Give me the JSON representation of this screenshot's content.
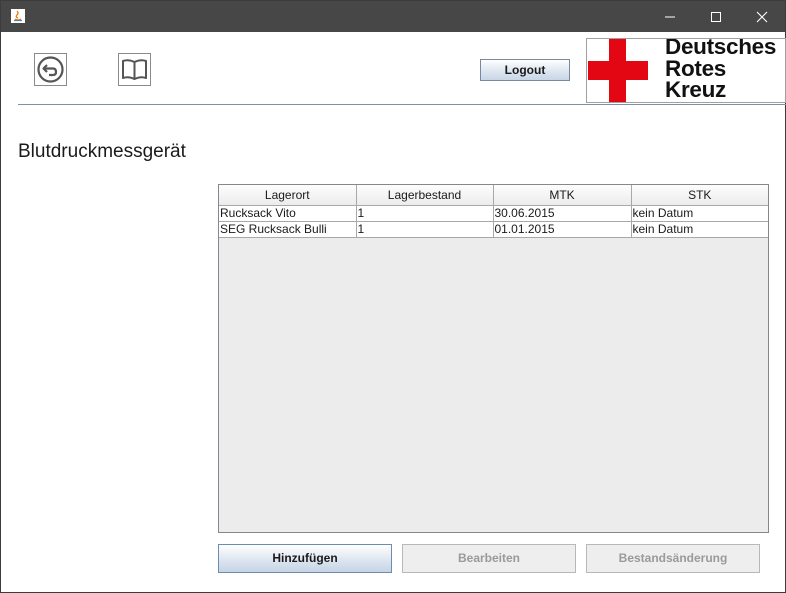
{
  "window": {
    "controls": {
      "minimize_icon": "minimize-icon",
      "maximize_icon": "maximize-icon",
      "close_icon": "close-icon"
    }
  },
  "toolbar": {
    "back_icon": "back-arrow-icon",
    "manual_icon": "book-icon",
    "logout_label": "Logout"
  },
  "logo": {
    "lines": [
      "Deutsches",
      "Rotes",
      "Kreuz"
    ],
    "cross_color": "#e30613"
  },
  "page": {
    "title": "Blutdruckmessgerät"
  },
  "table": {
    "columns": [
      "Lagerort",
      "Lagerbestand",
      "MTK",
      "STK"
    ],
    "rows": [
      [
        "Rucksack Vito",
        "1",
        "30.06.2015",
        "kein Datum"
      ],
      [
        "SEG Rucksack Bulli",
        "1",
        "01.01.2015",
        "kein Datum"
      ]
    ]
  },
  "actions": {
    "add_label": "Hinzufügen",
    "edit_label": "Bearbeiten",
    "stock_change_label": "Bestandsänderung"
  }
}
